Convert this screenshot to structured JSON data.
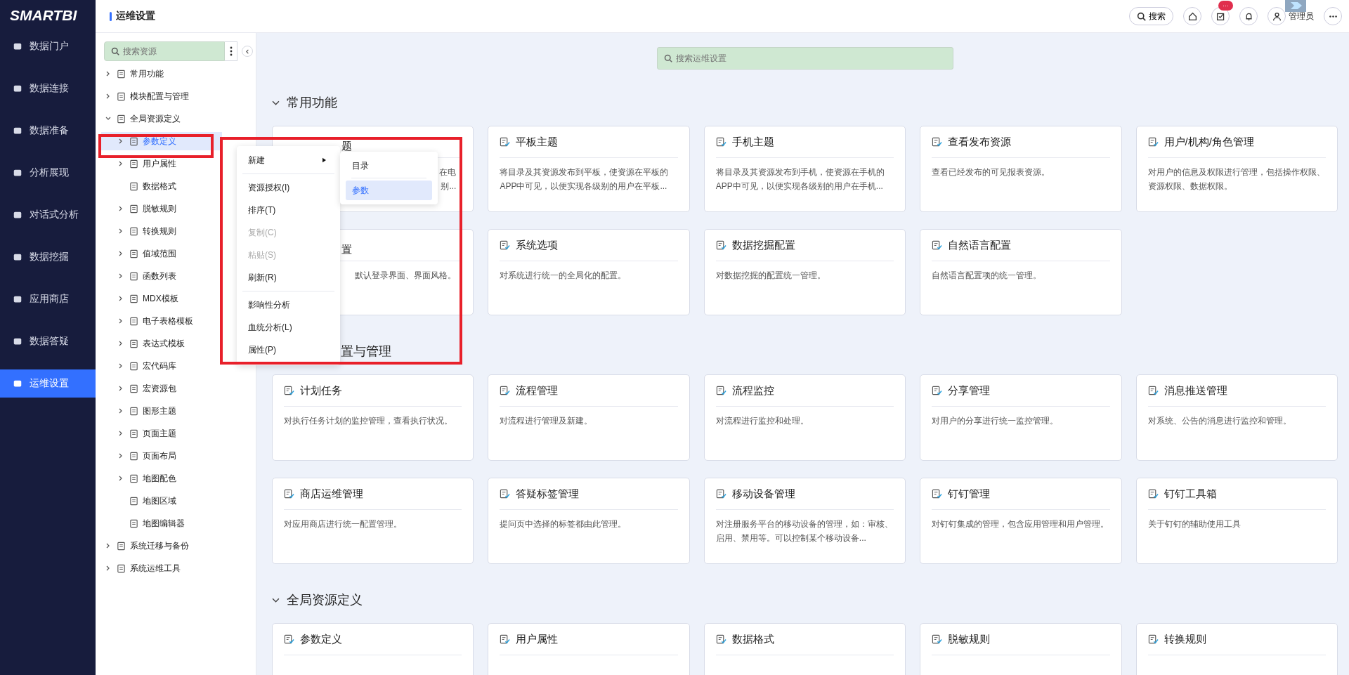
{
  "logo": "SMARTBI",
  "nav": [
    {
      "label": "数据门户",
      "selected": false
    },
    {
      "label": "数据连接",
      "selected": false
    },
    {
      "label": "数据准备",
      "selected": false
    },
    {
      "label": "分析展现",
      "selected": false
    },
    {
      "label": "对话式分析",
      "selected": false
    },
    {
      "label": "数据挖掘",
      "selected": false
    },
    {
      "label": "应用商店",
      "selected": false
    },
    {
      "label": "数据答疑",
      "selected": false
    },
    {
      "label": "运维设置",
      "selected": true
    }
  ],
  "header": {
    "title": "运维设置",
    "search_label": "搜索",
    "task_badge": "···",
    "user": "管理员"
  },
  "tree": {
    "search_placeholder": "搜索资源",
    "items": [
      {
        "label": "常用功能",
        "kind": "folder",
        "expanded": false,
        "selected": false
      },
      {
        "label": "模块配置与管理",
        "kind": "folder",
        "expanded": false,
        "selected": false
      },
      {
        "label": "全局资源定义",
        "kind": "folder",
        "expanded": true,
        "selected": false,
        "children": [
          {
            "label": "参数定义",
            "kind": "folder",
            "expanded": false,
            "selected": true
          },
          {
            "label": "用户属性",
            "kind": "folder",
            "expanded": false,
            "selected": false
          },
          {
            "label": "数据格式",
            "kind": "leaf",
            "selected": false
          },
          {
            "label": "脱敏规则",
            "kind": "folder",
            "expanded": false,
            "selected": false
          },
          {
            "label": "转换规则",
            "kind": "folder",
            "expanded": false,
            "selected": false
          },
          {
            "label": "值域范围",
            "kind": "folder",
            "expanded": false,
            "selected": false
          },
          {
            "label": "函数列表",
            "kind": "folder",
            "expanded": false,
            "selected": false
          },
          {
            "label": "MDX模板",
            "kind": "folder",
            "expanded": false,
            "selected": false
          },
          {
            "label": "电子表格模板",
            "kind": "folder",
            "expanded": false,
            "selected": false
          },
          {
            "label": "表达式模板",
            "kind": "folder",
            "expanded": false,
            "selected": false
          },
          {
            "label": "宏代码库",
            "kind": "folder",
            "expanded": false,
            "selected": false
          },
          {
            "label": "宏资源包",
            "kind": "folder",
            "expanded": false,
            "selected": false
          },
          {
            "label": "图形主题",
            "kind": "folder",
            "expanded": false,
            "selected": false
          },
          {
            "label": "页面主题",
            "kind": "folder",
            "expanded": false,
            "selected": false
          },
          {
            "label": "页面布局",
            "kind": "folder",
            "expanded": false,
            "selected": false
          },
          {
            "label": "地图配色",
            "kind": "folder",
            "expanded": false,
            "selected": false
          },
          {
            "label": "地图区域",
            "kind": "leaf",
            "selected": false
          },
          {
            "label": "地图编辑器",
            "kind": "leaf",
            "selected": false
          }
        ]
      },
      {
        "label": "系统迁移与备份",
        "kind": "folder",
        "expanded": false,
        "selected": false
      },
      {
        "label": "系统运维工具",
        "kind": "folder",
        "expanded": false,
        "selected": false
      }
    ]
  },
  "main": {
    "search_placeholder": "搜索运维设置",
    "sections": [
      {
        "title": "常用功能",
        "kind": "full",
        "cards": [
          {
            "kind": "partial",
            "title": "题",
            "desc_lines": [
              "在电",
              "别..."
            ]
          },
          {
            "kind": "full",
            "title": "平板主题",
            "desc": "将目录及其资源发布到平板，使资源在平板的APP中可见，以便实现各级别的用户在平板..."
          },
          {
            "kind": "full",
            "title": "手机主题",
            "desc": "将目录及其资源发布到手机，使资源在手机的APP中可见，以便实现各级别的用户在手机..."
          },
          {
            "kind": "full",
            "title": "查看发布资源",
            "desc": "查看已经发布的可见报表资源。"
          },
          {
            "kind": "full",
            "title": "用户/机构/角色管理",
            "desc": "对用户的信息及权限进行管理，包括操作权限、资源权限、数据权限。"
          },
          {
            "kind": "partial",
            "title": "置",
            "desc_lines": [
              "默认登录界面、界面风格。"
            ]
          },
          {
            "kind": "full",
            "title": "系统选项",
            "desc": "对系统进行统一的全局化的配置。"
          },
          {
            "kind": "full",
            "title": "数据挖掘配置",
            "desc": "对数据挖掘的配置统一管理。"
          },
          {
            "kind": "full",
            "title": "自然语言配置",
            "desc": "自然语言配置项的统一管理。"
          }
        ]
      },
      {
        "title": "置与管理",
        "kind": "partial",
        "cards": [
          {
            "kind": "full",
            "title": "计划任务",
            "desc": "对执行任务计划的监控管理，查看执行状况。"
          },
          {
            "kind": "full",
            "title": "流程管理",
            "desc": "对流程进行管理及新建。"
          },
          {
            "kind": "full",
            "title": "流程监控",
            "desc": "对流程进行监控和处理。"
          },
          {
            "kind": "full",
            "title": "分享管理",
            "desc": "对用户的分享进行统一监控管理。"
          },
          {
            "kind": "full",
            "title": "消息推送管理",
            "desc": "对系统、公告的消息进行监控和管理。"
          },
          {
            "kind": "full",
            "title": "商店运维管理",
            "desc": "对应用商店进行统一配置管理。"
          },
          {
            "kind": "full",
            "title": "答疑标签管理",
            "desc": "提问页中选择的标签都由此管理。"
          },
          {
            "kind": "full",
            "title": "移动设备管理",
            "desc": "对注册服务平台的移动设备的管理，如：审核、启用、禁用等。可以控制某个移动设备..."
          },
          {
            "kind": "full",
            "title": "钉钉管理",
            "desc": "对钉钉集成的管理，包含应用管理和用户管理。"
          },
          {
            "kind": "full",
            "title": "钉钉工具箱",
            "desc": "关于钉钉的辅助使用工具"
          }
        ]
      },
      {
        "title": "全局资源定义",
        "kind": "full",
        "cards": [
          {
            "kind": "full",
            "title": "参数定义"
          },
          {
            "kind": "full",
            "title": "用户属性"
          },
          {
            "kind": "full",
            "title": "数据格式"
          },
          {
            "kind": "full",
            "title": "脱敏规则"
          },
          {
            "kind": "full",
            "title": "转换规则"
          }
        ]
      }
    ]
  },
  "context_menu": {
    "groups": [
      [
        {
          "label": "新建",
          "kind": "submenu",
          "disabled": false
        }
      ],
      [
        {
          "label": "资源授权(I)",
          "kind": "item",
          "disabled": false
        },
        {
          "label": "排序(T)",
          "kind": "item",
          "disabled": false
        },
        {
          "label": "复制(C)",
          "kind": "item",
          "disabled": true
        },
        {
          "label": "粘贴(S)",
          "kind": "item",
          "disabled": true
        },
        {
          "label": "刷新(R)",
          "kind": "item",
          "disabled": false
        }
      ],
      [
        {
          "label": "影响性分析",
          "kind": "item",
          "disabled": false
        },
        {
          "label": "血统分析(L)",
          "kind": "item",
          "disabled": false
        },
        {
          "label": "属性(P)",
          "kind": "item",
          "disabled": false
        }
      ]
    ],
    "submenu": [
      {
        "label": "目录",
        "selected": false
      },
      {
        "label": "参数",
        "selected": true
      }
    ]
  }
}
